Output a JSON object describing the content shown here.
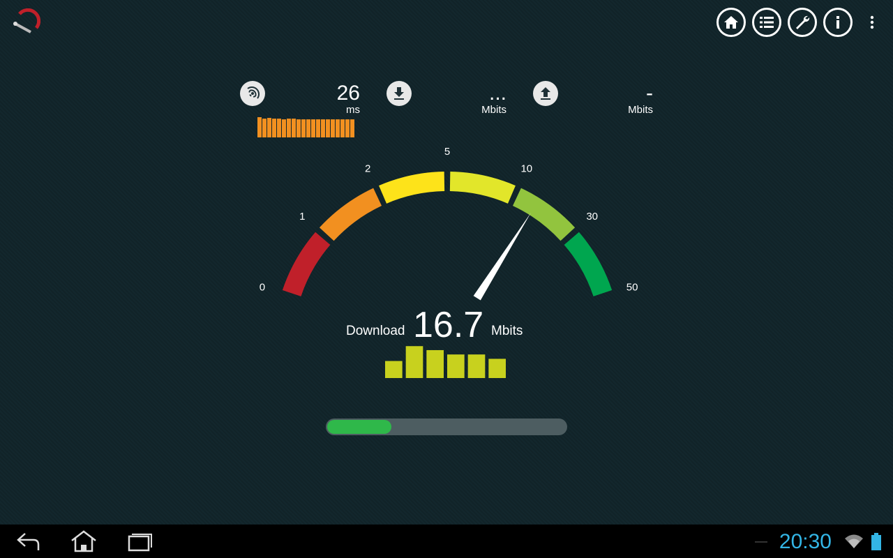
{
  "ping": {
    "value": "26",
    "unit": "ms",
    "history": [
      28,
      26,
      27,
      26,
      26,
      25,
      26,
      26,
      25,
      25,
      25,
      25,
      25,
      25,
      25,
      25,
      25,
      25,
      25,
      25
    ]
  },
  "download_stat": {
    "value": "...",
    "unit": "Mbits"
  },
  "upload_stat": {
    "value": "-",
    "unit": "Mbits"
  },
  "gauge": {
    "ticks": [
      "0",
      "1",
      "2",
      "5",
      "10",
      "30",
      "50"
    ],
    "needle_value": 16.7,
    "colors": [
      "#c0202a",
      "#f29020",
      "#fde31a",
      "#e2e62a",
      "#92c43e",
      "#00a64f"
    ]
  },
  "download": {
    "label": "Download",
    "value": "16.7",
    "unit": "Mbits",
    "history": [
      0.47,
      0.88,
      0.77,
      0.65,
      0.65,
      0.53
    ]
  },
  "progress": {
    "fraction": 0.27
  },
  "status_bar": {
    "time": "20:30"
  },
  "icons": {
    "toolbar": [
      "home-icon",
      "list-icon",
      "wrench-icon",
      "info-icon",
      "overflow-menu-icon"
    ],
    "nav": [
      "back-icon",
      "home-icon",
      "recent-apps-icon"
    ],
    "system": [
      "wifi-icon",
      "battery-icon"
    ]
  }
}
